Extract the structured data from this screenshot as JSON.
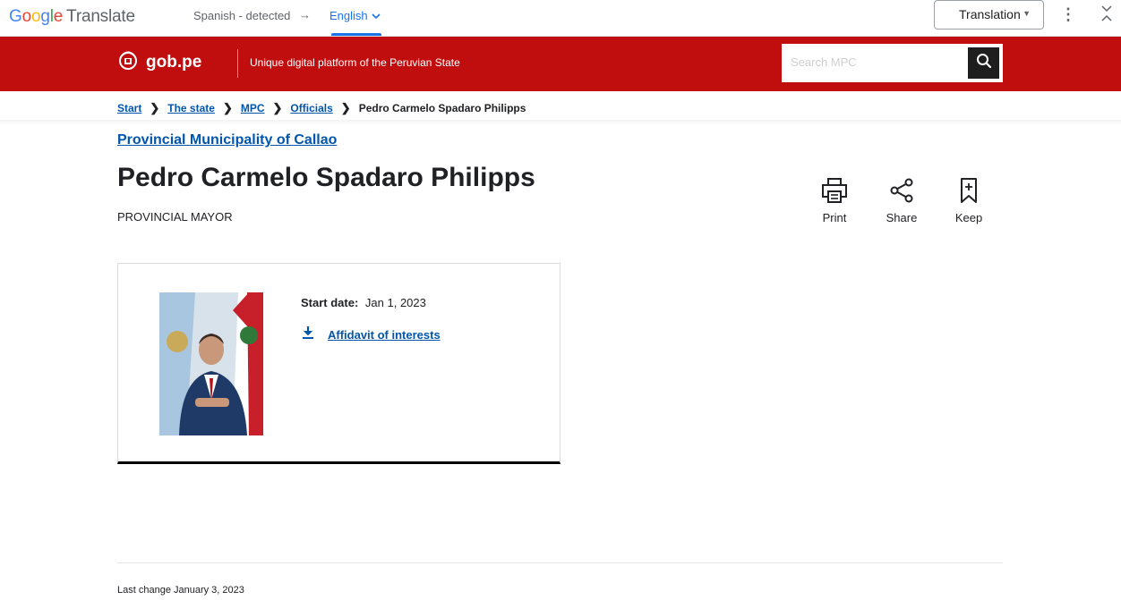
{
  "translate_bar": {
    "logo_letters": [
      "G",
      "o",
      "o",
      "g",
      "l",
      "e"
    ],
    "logo_suffix": "Translate",
    "source_language": "Spanish - detected",
    "arrow": "→",
    "target_language": "English",
    "mode_select": "Translation",
    "more_icon": "more-vert-icon",
    "collapse_icon": "collapse-icon"
  },
  "header": {
    "logo_text": "gob.pe",
    "tagline": "Unique digital platform of the Peruvian State",
    "search_placeholder": "Search MPC",
    "search_icon": "search-icon",
    "brand_color": "#c00d0e"
  },
  "breadcrumb": {
    "items": [
      "Start",
      "The state",
      "MPC",
      "Officials"
    ],
    "current": "Pedro Carmelo Spadaro Philipps",
    "separator": ">"
  },
  "entity": {
    "org": "Provincial Municipality of Callao",
    "name": "Pedro Carmelo Spadaro Philipps",
    "role": "PROVINCIAL MAYOR"
  },
  "actions": [
    {
      "label": "Print",
      "icon": "print-icon"
    },
    {
      "label": "Share",
      "icon": "share-icon"
    },
    {
      "label": "Keep",
      "icon": "bookmark-icon"
    }
  ],
  "card": {
    "start_date_label": "Start date:",
    "start_date_value": "Jan 1, 2023",
    "affidavit_label": "Affidavit of interests",
    "download_icon": "download-icon"
  },
  "footer": {
    "last_change": "Last change January 3, 2023"
  }
}
